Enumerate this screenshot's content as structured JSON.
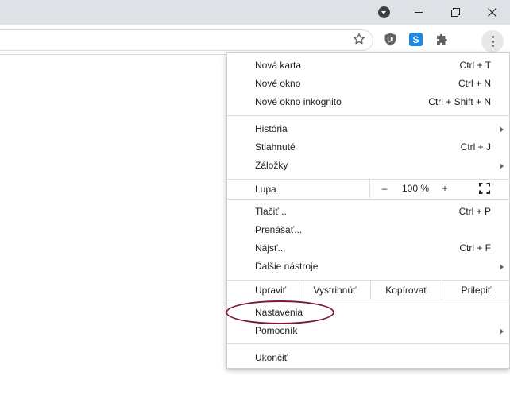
{
  "window": {
    "controls": {
      "minimize_icon": "minimize-icon",
      "restore_icon": "restore-icon",
      "close_icon": "close-icon"
    }
  },
  "toolbar": {
    "icons": [
      "star-icon",
      "ublock-icon",
      "skype-icon",
      "puzzle-icon",
      "more-vert-icon"
    ],
    "skype_letter": "S"
  },
  "menu": {
    "new_tab": {
      "label": "Nová karta",
      "shortcut": "Ctrl + T"
    },
    "new_window": {
      "label": "Nové okno",
      "shortcut": "Ctrl + N"
    },
    "incognito": {
      "label": "Nové okno inkognito",
      "shortcut": "Ctrl + Shift + N"
    },
    "history": {
      "label": "História"
    },
    "downloads": {
      "label": "Stiahnuté",
      "shortcut": "Ctrl + J"
    },
    "bookmarks": {
      "label": "Záložky"
    },
    "zoom": {
      "label": "Lupa",
      "minus": "–",
      "value": "100 %",
      "plus": "+"
    },
    "print": {
      "label": "Tlačiť...",
      "shortcut": "Ctrl + P"
    },
    "cast": {
      "label": "Prenášať..."
    },
    "find": {
      "label": "Nájsť...",
      "shortcut": "Ctrl + F"
    },
    "more_tools": {
      "label": "Ďalšie nástroje"
    },
    "edit": {
      "label": "Upraviť",
      "cut": "Vystrihnúť",
      "copy": "Kopírovať",
      "paste": "Prilepiť"
    },
    "settings": {
      "label": "Nastavenia"
    },
    "help": {
      "label": "Pomocník"
    },
    "exit": {
      "label": "Ukončiť"
    }
  },
  "colors": {
    "titlebar": "#dee1e6",
    "annotation": "#7b1a2e"
  }
}
